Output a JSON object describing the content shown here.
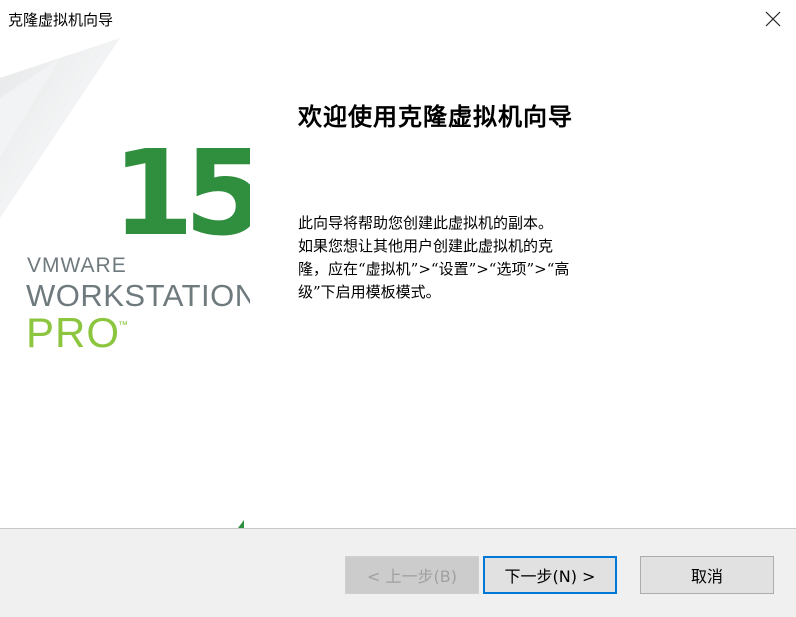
{
  "window": {
    "title": "克隆虚拟机向导"
  },
  "banner": {
    "brand_number": "15",
    "brand_vmware": "VMWARE",
    "brand_workstation": "WORKSTATION",
    "brand_pro": "PRO",
    "brand_tm": "™",
    "colors": {
      "green_dark": "#2f8f3f",
      "green_light": "#8cc63f",
      "gray": "#6f7a7e"
    }
  },
  "main": {
    "heading": "欢迎使用克隆虚拟机向导",
    "desc_lines": [
      "此向导将帮助您创建此虚拟机的副本。",
      "如果您想让其他用户创建此虚拟机的克",
      "隆，应在“虚拟机”>“设置”>“选项”>“高",
      "级”下启用模板模式。"
    ]
  },
  "buttons": {
    "back": "< 上一步(B)",
    "next": "下一步(N) >",
    "cancel": "取消"
  }
}
